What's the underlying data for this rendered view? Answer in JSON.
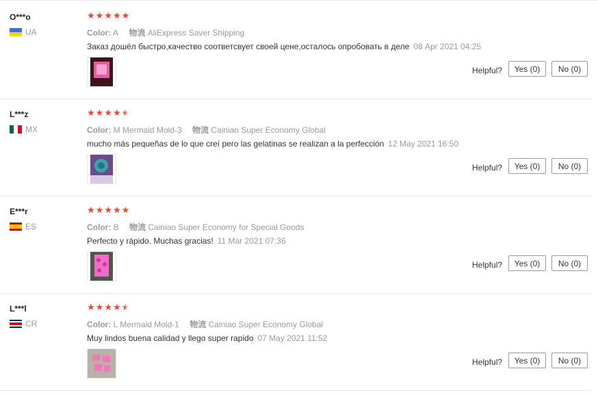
{
  "reviews": [
    {
      "user": "O***o",
      "country": "UA",
      "rating": 5,
      "color_label": "Color:",
      "color_value": "A",
      "shipping_label": "物流",
      "shipping_value": "AliExpress Saver Shipping",
      "text": "Заказ дошёл быстро,качество соответсвует своей цене,осталось опробовать в деле",
      "date": "08 Apr 2021 04:25",
      "helpful_label": "Helpful?",
      "yes_label": "Yes (0)",
      "no_label": "No (0)",
      "thumb_colors": [
        "#e85ca6",
        "#3a1418"
      ]
    },
    {
      "user": "L***z",
      "country": "MX",
      "rating": 4.5,
      "color_label": "Color:",
      "color_value": "M Mermaid Mold-3",
      "shipping_label": "物流",
      "shipping_value": "Cainiao Super Economy Global",
      "text": "mucho más pequeñas de lo que creí pero las gelatinas se realizan a la perfección",
      "date": "12 May 2021 16:50",
      "helpful_label": "Helpful?",
      "yes_label": "Yes (0)",
      "no_label": "No (0)",
      "thumb_colors": [
        "#3aa6a0",
        "#6a4c8c"
      ]
    },
    {
      "user": "E***r",
      "country": "ES",
      "rating": 5,
      "color_label": "Color:",
      "color_value": "B",
      "shipping_label": "物流",
      "shipping_value": "Cainiao Super Economy for Special Goods",
      "text": "Perfecto y rápido. Muchas gracias!",
      "date": "11 Mar 2021 07:36",
      "helpful_label": "Helpful?",
      "yes_label": "Yes (0)",
      "no_label": "No (0)",
      "thumb_colors": [
        "#f06cc8",
        "#4f5a46"
      ]
    },
    {
      "user": "L***l",
      "country": "CR",
      "rating": 4.5,
      "color_label": "Color:",
      "color_value": "L Mermaid Mold-1",
      "shipping_label": "物流",
      "shipping_value": "Cainiao Super Economy Global",
      "text": "Muy lindos buena calidad y llego super rapido",
      "date": "07 May 2021 11:52",
      "helpful_label": "Helpful?",
      "yes_label": "Yes (0)",
      "no_label": "No (0)",
      "thumb_colors": [
        "#f07ab8",
        "#b9b2aa"
      ]
    }
  ],
  "colors": {
    "star": "#f44336",
    "meta_gray": "#999999",
    "divider": "#e8e8e8"
  }
}
